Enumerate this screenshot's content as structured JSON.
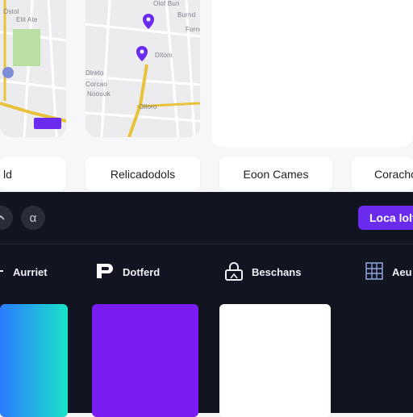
{
  "map": {
    "left_labels": [
      "Ostol",
      "Elit Ate"
    ],
    "right_labels": [
      "Olof Bun",
      "Burnd",
      "Fornd",
      "Dltom",
      "Dlreto",
      "Corcao",
      "Noouuk",
      "Olloro"
    ]
  },
  "chips": [
    "ld",
    "Relicadodols",
    "Eoon Cames",
    "Coracho"
  ],
  "toolbar": {
    "back_icon": "chevron-icon",
    "alpha_symbol": "α",
    "cta_label": "Loca lolt"
  },
  "tabs": [
    {
      "label": "Aurriet",
      "icon": "minus-icon"
    },
    {
      "label": "Dotferd",
      "icon": "logo-icon"
    },
    {
      "label": "Beschans",
      "icon": "lock-icon"
    },
    {
      "label": "Aeu",
      "icon": "grid-icon"
    }
  ],
  "colors": {
    "accent": "#6b2bee",
    "dark_bg": "#121421",
    "road": "#e8c23a",
    "pin": "#6b2bee",
    "swatch_gradient_from": "#2b7bff",
    "swatch_gradient_to": "#19e3c8",
    "swatch_purple": "#7a1cf4",
    "swatch_white": "#ffffff"
  }
}
